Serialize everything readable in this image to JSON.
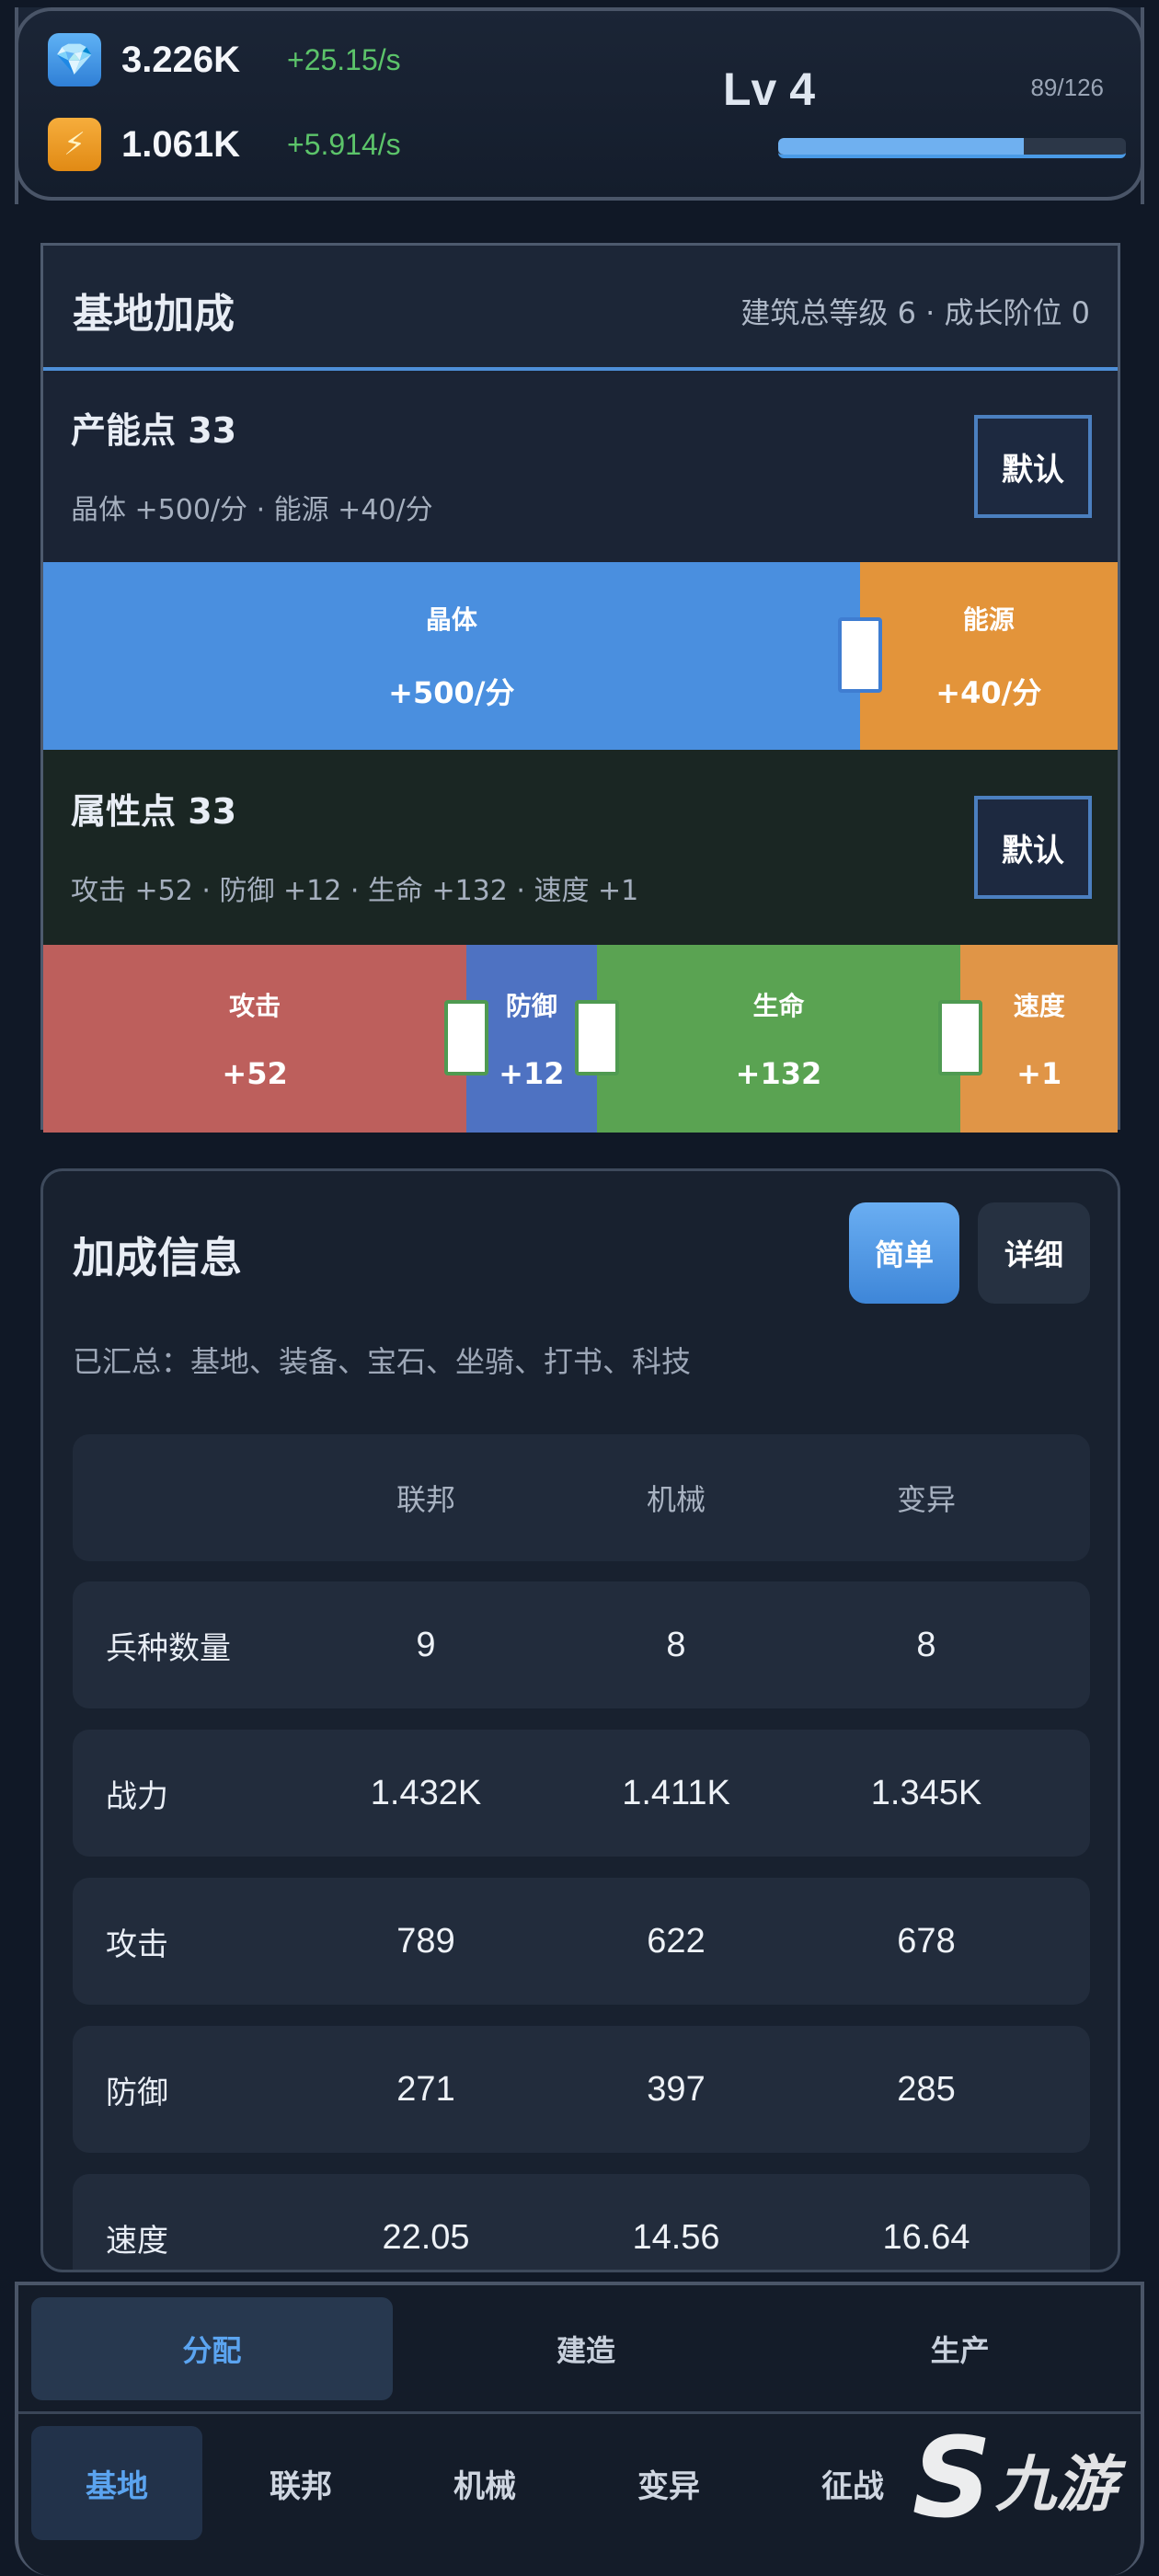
{
  "resources": [
    {
      "icon": "crystal-icon",
      "glyph": "💎",
      "amount": "3.226K",
      "rate": "+25.15/s"
    },
    {
      "icon": "energy-icon",
      "glyph": "⚡",
      "amount": "1.061K",
      "rate": "+5.914/s"
    }
  ],
  "level": {
    "label": "Lv 4",
    "xp_text": "89/126",
    "xp_fraction": 0.706
  },
  "base_bonus": {
    "title": "基地加成",
    "meta": "建筑总等级 6 · 成长阶位 0",
    "production": {
      "title": "产能点 33",
      "summary": "晶体 +500/分 · 能源 +40/分",
      "default_label": "默认",
      "segments": [
        {
          "name": "晶体",
          "value": "+500/分",
          "color": "#4a8fdf",
          "share": 0.76
        },
        {
          "name": "能源",
          "value": "+40/分",
          "color": "#e3943a",
          "share": 0.24
        }
      ]
    },
    "attributes": {
      "title": "属性点 33",
      "summary": "攻击 +52 · 防御 +12 · 生命 +132 · 速度 +1",
      "default_label": "默认",
      "segments": [
        {
          "name": "攻击",
          "value": "+52",
          "color": "#bd5f5c",
          "share": 0.394
        },
        {
          "name": "防御",
          "value": "+12",
          "color": "#4e72c2",
          "share": 0.121
        },
        {
          "name": "生命",
          "value": "+132",
          "color": "#5aa352",
          "share": 0.339
        },
        {
          "name": "速度",
          "value": "+1",
          "color": "#e09547",
          "share": 0.146
        }
      ]
    }
  },
  "bonus_info": {
    "title": "加成信息",
    "simple_label": "简单",
    "detail_label": "详细",
    "summary": "已汇总：基地、装备、宝石、坐骑、打书、科技",
    "columns": [
      "联邦",
      "机械",
      "变异"
    ],
    "rows": [
      {
        "label": "兵种数量",
        "values": [
          "9",
          "8",
          "8"
        ]
      },
      {
        "label": "战力",
        "values": [
          "1.432K",
          "1.411K",
          "1.345K"
        ]
      },
      {
        "label": "攻击",
        "values": [
          "789",
          "622",
          "678"
        ]
      },
      {
        "label": "防御",
        "values": [
          "271",
          "397",
          "285"
        ]
      },
      {
        "label": "速度",
        "values": [
          "22.05",
          "14.56",
          "16.64"
        ]
      }
    ]
  },
  "sub_tabs": [
    "分配",
    "建造",
    "生产"
  ],
  "main_tabs": [
    "基地",
    "联邦",
    "机械",
    "变异",
    "征战"
  ],
  "watermark": {
    "mark": "S",
    "text": "九游"
  },
  "colors": {
    "accent": "#5ba4f0",
    "rate_green": "#5cc46a"
  }
}
